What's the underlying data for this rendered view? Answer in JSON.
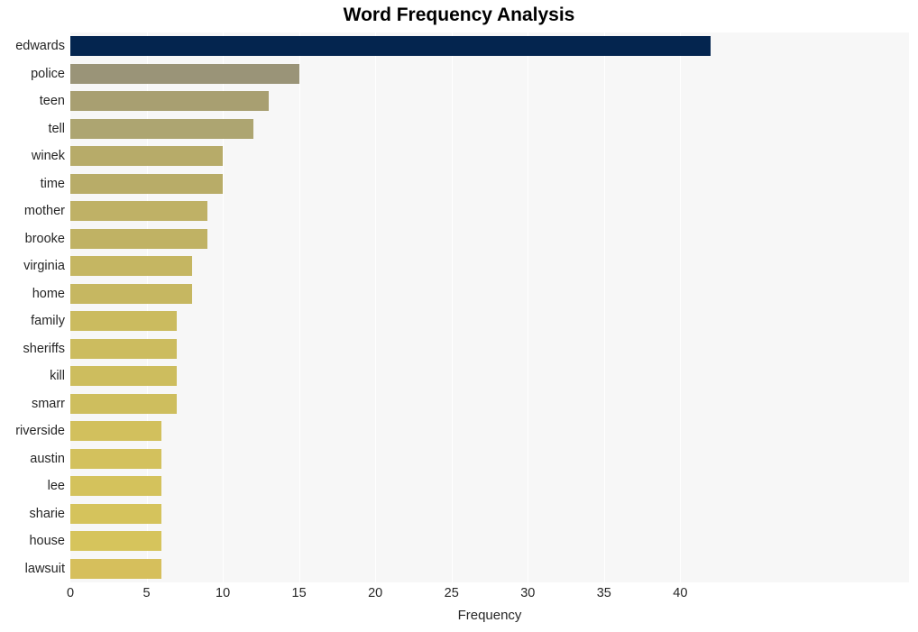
{
  "chart_data": {
    "type": "bar",
    "orientation": "horizontal",
    "title": "Word Frequency Analysis",
    "xlabel": "Frequency",
    "ylabel": "",
    "categories": [
      "edwards",
      "police",
      "teen",
      "tell",
      "winek",
      "time",
      "mother",
      "brooke",
      "virginia",
      "home",
      "family",
      "sheriffs",
      "kill",
      "smarr",
      "riverside",
      "austin",
      "lee",
      "sharie",
      "house",
      "lawsuit"
    ],
    "values": [
      42,
      15,
      13,
      12,
      10,
      10,
      9,
      9,
      8,
      8,
      7,
      7,
      7,
      7,
      6,
      6,
      6,
      6,
      6,
      6
    ],
    "bar_colors": [
      "#04254f",
      "#9a9478",
      "#a89f71",
      "#ada571",
      "#b7ab69",
      "#b8ac68",
      "#bfb166",
      "#c0b264",
      "#c5b662",
      "#c6b761",
      "#cbbb5f",
      "#ccbc5f",
      "#cdbd5e",
      "#cebe5e",
      "#d2c05d",
      "#d3c15d",
      "#d4c25c",
      "#d5c35c",
      "#d6c45c",
      "#d6bf5c"
    ],
    "xlim": [
      0,
      55
    ],
    "xticks": [
      0,
      5,
      10,
      15,
      20,
      25,
      30,
      35,
      40
    ],
    "xticklabels": [
      "0",
      "5",
      "10",
      "15",
      "20",
      "25",
      "30",
      "35",
      "40"
    ],
    "grid": true,
    "grid_axis": "x",
    "grid_color": "#ffffff",
    "legend": false,
    "plot_background": "#f7f7f7",
    "figure_background": "#ffffff",
    "tick_label_color": "#262626",
    "title_color": "#000000"
  }
}
